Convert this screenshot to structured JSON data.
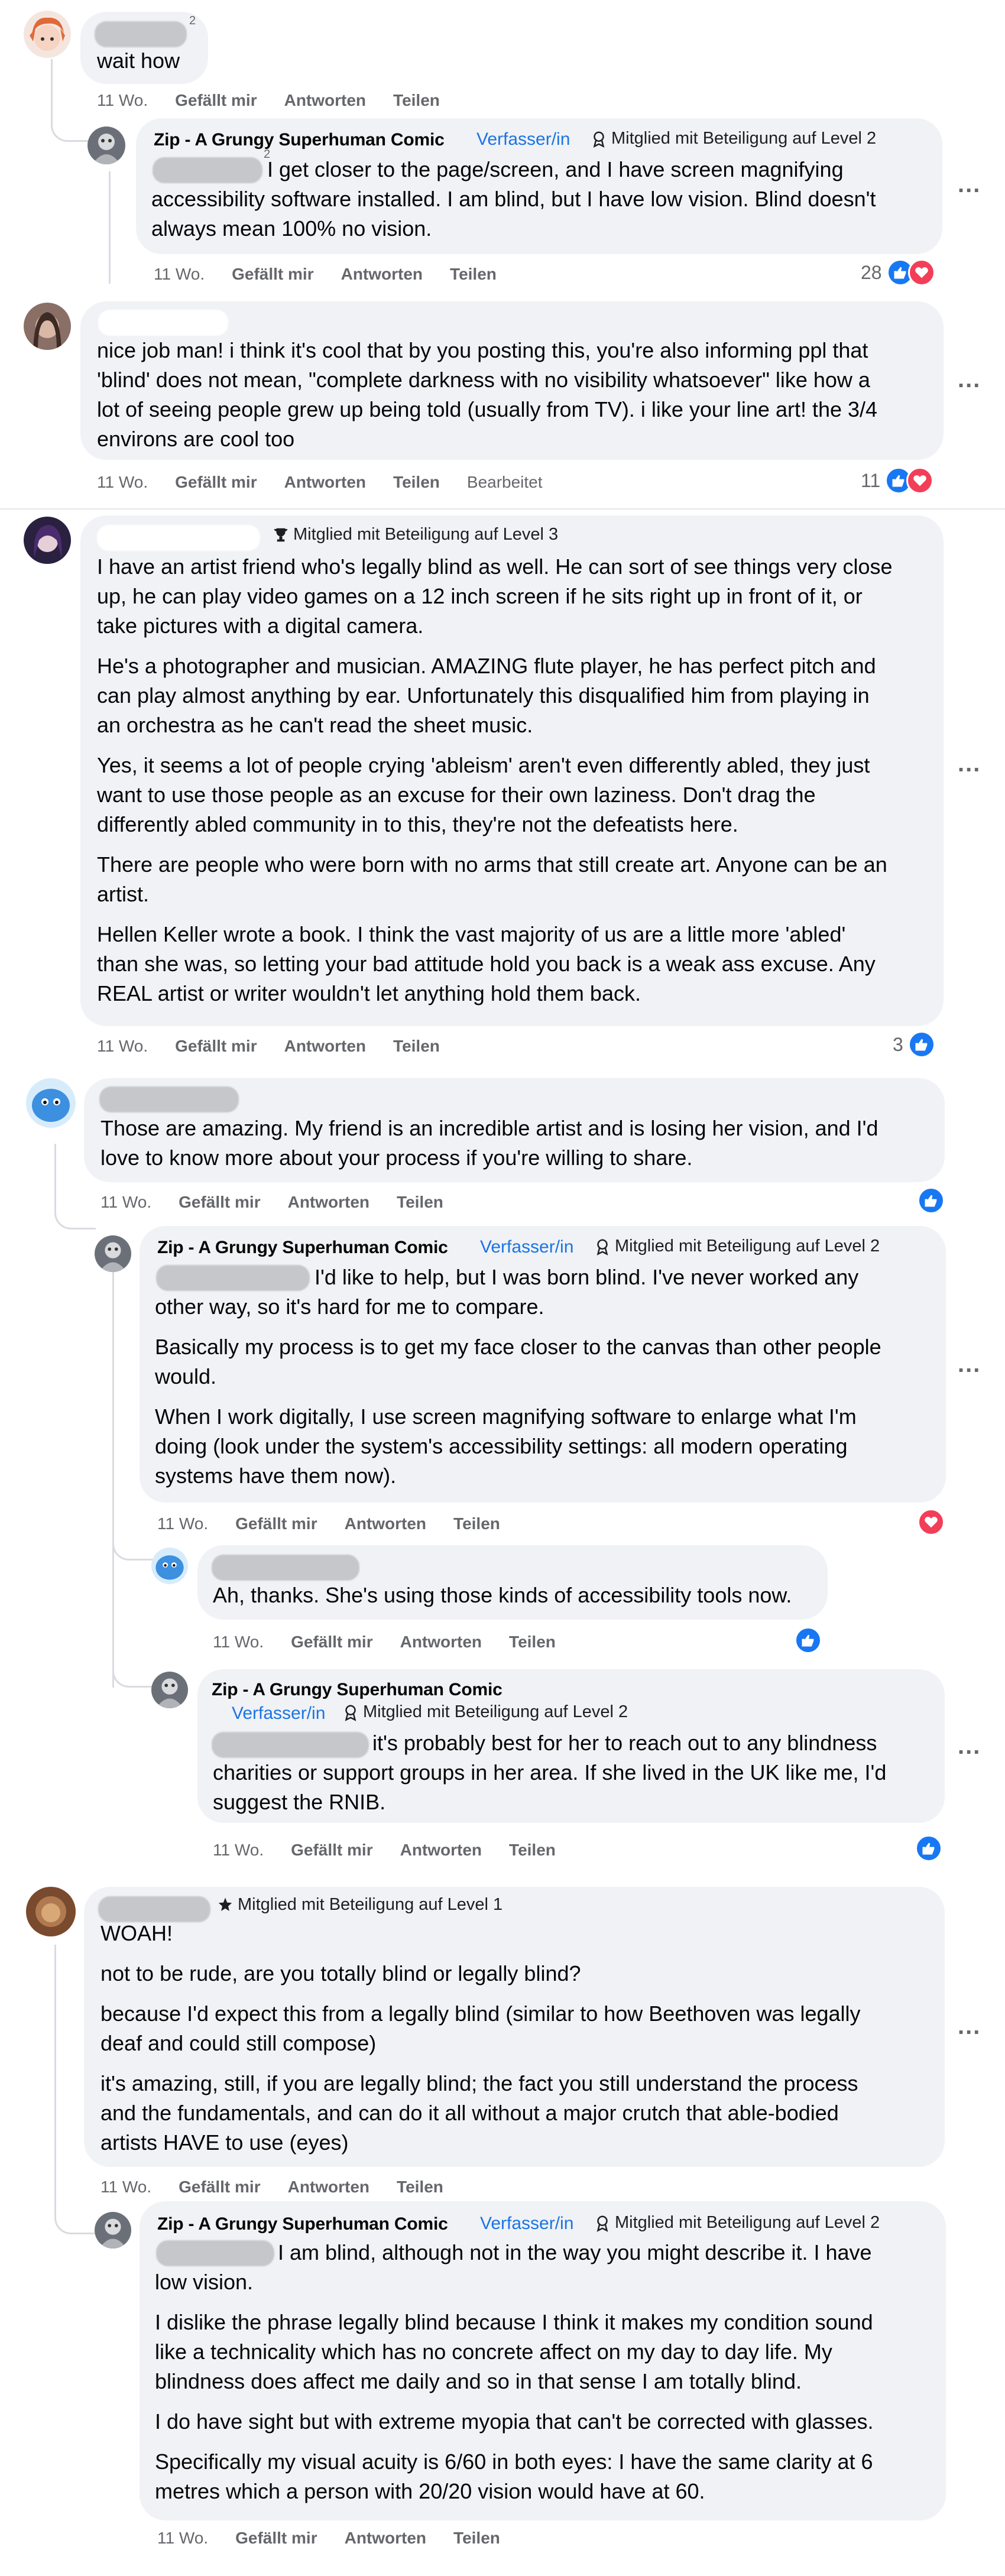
{
  "actions": {
    "like": "Gefällt mir",
    "reply": "Antworten",
    "share": "Teilen",
    "edited": "Bearbeitet"
  },
  "labels": {
    "author": "Verfasser/in",
    "badge_l1": "Mitglied mit Beteiligung auf Level 1",
    "badge_l2": "Mitglied mit Beteiligung auf Level 2",
    "badge_l3": "Mitglied mit Beteiligung auf Level 3"
  },
  "more": "...",
  "comments": [
    {
      "id": "c1",
      "text": "wait how",
      "time": "11 Wo.",
      "superscript": "2"
    },
    {
      "id": "c1r1",
      "name": "Zip - A Grungy Superhuman Comic",
      "superscript": "2",
      "lines": [
        "I get closer to the page/screen, and I have screen magnifying",
        "accessibility software installed. I am blind, but I have low vision. Blind doesn't",
        "always mean 100% no vision."
      ],
      "time": "11 Wo.",
      "reactions": "28"
    },
    {
      "id": "c2",
      "lines": [
        "nice job man! i think it's cool that by you posting this, you're also informing ppl that",
        "'blind' does not mean, \"complete darkness with no visibility whatsoever\" like how a",
        "lot of seeing people grew up being told (usually from TV). i like your line art! the 3/4",
        "environs are cool too"
      ],
      "time": "11 Wo.",
      "reactions": "11"
    },
    {
      "id": "c3",
      "paragraphs": [
        [
          "I have an artist friend who's legally blind as well. He can sort of see things very close",
          "up, he can play video games on a 12 inch screen if he sits right up in front of it, or",
          "take pictures with a digital camera."
        ],
        [
          "He's a photographer and musician. AMAZING flute player, he has perfect pitch and",
          "can play almost anything by ear. Unfortunately this disqualified him from playing in",
          "an orchestra as he can't read the sheet music."
        ],
        [
          "Yes, it seems a lot of people crying 'ableism' aren't even differently abled, they just",
          "want to use those people as an excuse for their own laziness. Don't drag the",
          "differently abled community in to this, they're not the defeatists here."
        ],
        [
          "There are people who were born with no arms that still create art. Anyone can be an",
          "artist."
        ],
        [
          "Hellen Keller wrote a book. I think the vast majority of us are a little more 'abled'",
          "than she was, so letting your bad attitude hold you back is a weak ass excuse. Any",
          "REAL artist or writer wouldn't let anything hold them back."
        ]
      ],
      "time": "11 Wo.",
      "reactions": "3"
    },
    {
      "id": "c4",
      "lines": [
        "Those are amazing. My friend is an incredible artist and is losing her vision, and I'd",
        "love to know more about your process if you're willing to share."
      ],
      "time": "11 Wo."
    },
    {
      "id": "c4r1",
      "name": "Zip - A Grungy Superhuman Comic",
      "paragraphs": [
        [
          "I'd like to help, but I was born blind. I've never worked any",
          "other way, so it's hard for me to compare."
        ],
        [
          "Basically my process is to get my face closer to the canvas than other people",
          "would."
        ],
        [
          "When I work digitally, I use screen magnifying software to enlarge what I'm",
          "doing (look under the system's accessibility settings: all modern operating",
          "systems have them now)."
        ]
      ],
      "time": "11 Wo."
    },
    {
      "id": "c4r2",
      "text": "Ah, thanks. She's using those kinds of accessibility tools now.",
      "time": "11 Wo."
    },
    {
      "id": "c4r3",
      "name": "Zip - A Grungy Superhuman Comic",
      "lines": [
        "it's probably best for her to reach out to any blindness",
        "charities or support groups in her area. If she lived in the UK like me, I'd",
        "suggest the RNIB."
      ],
      "time": "11 Wo."
    },
    {
      "id": "c5",
      "paragraphs": [
        [
          "WOAH!"
        ],
        [
          "not to be rude, are you totally blind or legally blind?"
        ],
        [
          "because I'd expect this from a legally blind (similar to how Beethoven was legally",
          "deaf and could still compose)"
        ],
        [
          "it's amazing, still, if you are legally blind; the fact you still understand the process",
          "and the fundamentals, and can do it all without a major crutch that able-bodied",
          "artists HAVE to use (eyes)"
        ]
      ],
      "time": "11 Wo."
    },
    {
      "id": "c5r1",
      "name": "Zip - A Grungy Superhuman Comic",
      "paragraphs": [
        [
          "I am blind, although not in the way you might describe it. I have",
          "low vision."
        ],
        [
          "I dislike the phrase legally blind because I think it makes my condition sound",
          "like a technicality which has no concrete affect on my day to day life. My",
          "blindness does affect me daily and so in that sense I am totally blind."
        ],
        [
          "I do have sight but with extreme myopia that can't be corrected with glasses."
        ],
        [
          "Specifically my visual acuity is 6/60 in both eyes: I have the same clarity at 6",
          "metres which a person with 20/20 vision would have at 60."
        ]
      ],
      "time": "11 Wo."
    }
  ]
}
